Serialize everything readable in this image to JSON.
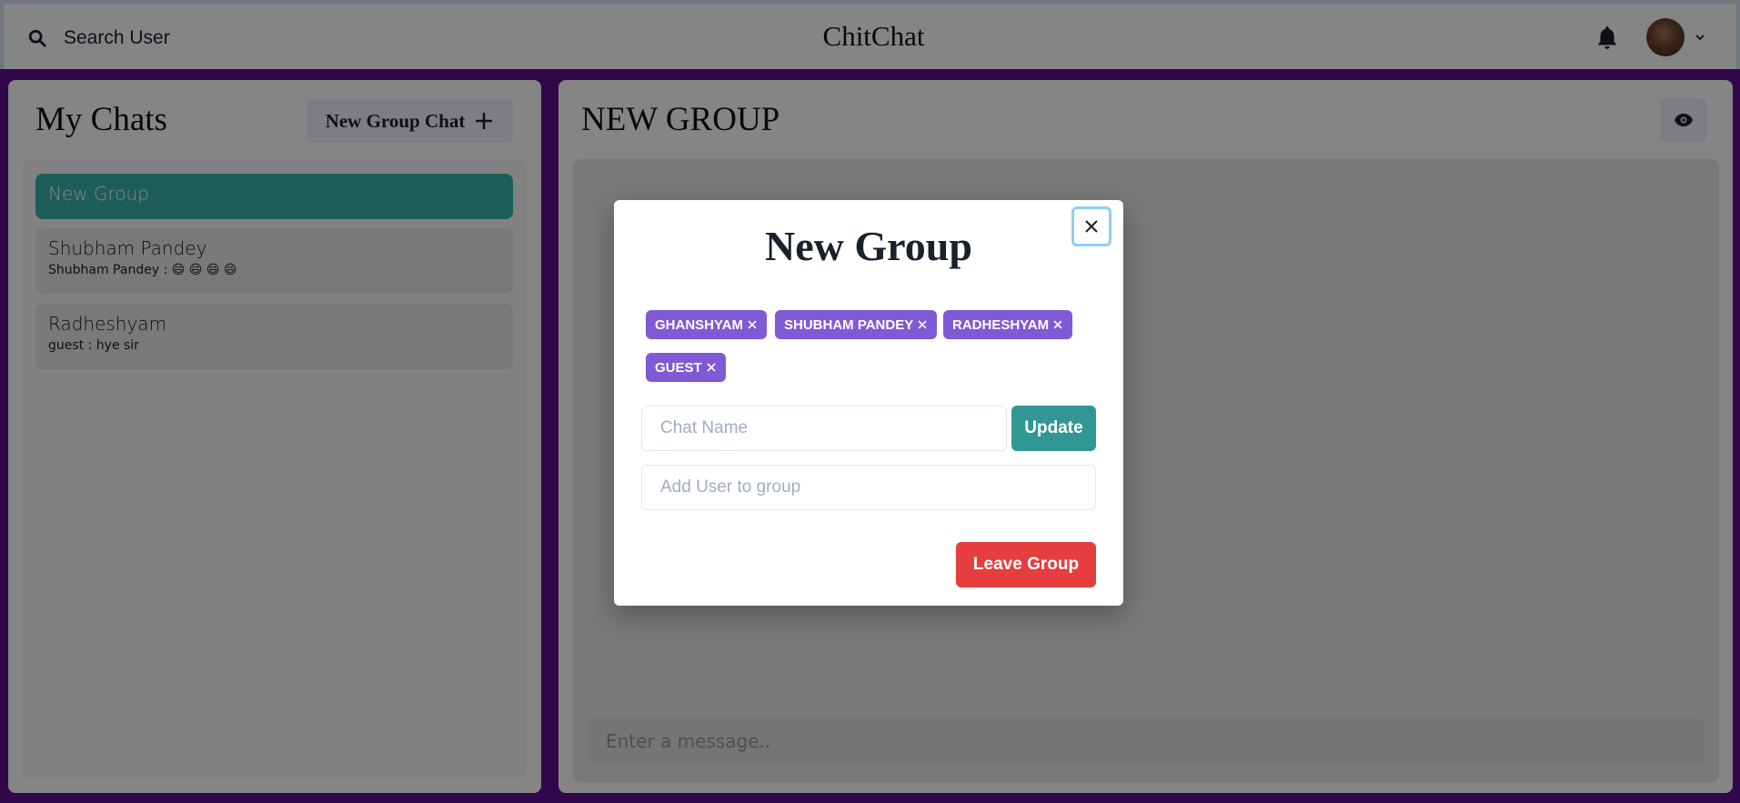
{
  "header": {
    "search_label": "Search User",
    "app_title": "ChitChat"
  },
  "sidebar": {
    "title": "My Chats",
    "new_group_label": "New Group Chat",
    "chats": [
      {
        "name": "New Group",
        "active": true
      },
      {
        "name": "Shubham Pandey",
        "preview_sender": "Shubham Pandey :",
        "preview_text": "😄 😄 😄 😄"
      },
      {
        "name": "Radheshyam",
        "preview_sender": "guest :",
        "preview_text": "hye sir"
      }
    ]
  },
  "main": {
    "chat_title": "NEW GROUP",
    "message_placeholder": "Enter a message.."
  },
  "modal": {
    "title": "New Group",
    "members": [
      "GHANSHYAM",
      "SHUBHAM PANDEY",
      "RADHESHYAM",
      "GUEST"
    ],
    "chat_name_placeholder": "Chat Name",
    "update_label": "Update",
    "add_user_placeholder": "Add User to group",
    "leave_label": "Leave Group"
  },
  "colors": {
    "brand_purple": "#5b0f8f",
    "active_chat": "#38b2ac",
    "badge": "#805ad5",
    "update": "#319795",
    "danger": "#e53e3e"
  }
}
